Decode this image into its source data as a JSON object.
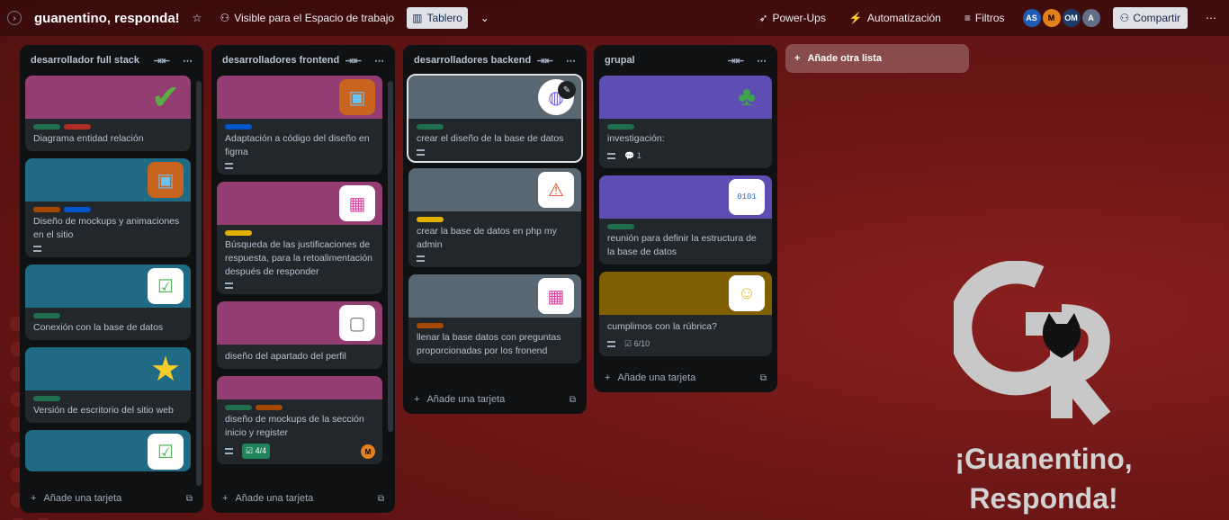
{
  "colors": {
    "green": "#216e4e",
    "red": "#ae2e24",
    "orange": "#a54800",
    "blue": "#0055cc",
    "yellow": "#e2b203",
    "pink": "#943d73",
    "teal": "#206a83",
    "slate": "#596773",
    "purple": "#5e4db2",
    "olive": "#7f5f01"
  },
  "topbar": {
    "title": "guanentino, responda!",
    "visibility": "Visible para el Espacio de trabajo",
    "view": "Tablero",
    "powerups": "Power-Ups",
    "automation": "Automatización",
    "filters": "Filtros",
    "share": "Compartir",
    "avatars": [
      "AS",
      "M",
      "OM",
      "A"
    ]
  },
  "lists": [
    {
      "title": "desarrollador full stack",
      "add": "Añade una tarjeta",
      "cards": [
        {
          "title": "Diagrama entidad relación",
          "sticker": "check-sticker-icon"
        },
        {
          "title": "Diseño de mockups y animaciones en el sitio",
          "sticker": "box-sticker-icon"
        },
        {
          "title": "Conexión con la base de datos",
          "sticker": "computer-sticker-icon"
        },
        {
          "title": "Versión de escritorio del sitio web",
          "sticker": "star-sticker-icon"
        },
        {
          "title": "",
          "sticker": "computer-sticker-icon"
        }
      ]
    },
    {
      "title": "desarrolladores frontend",
      "add": "Añade una tarjeta",
      "cards": [
        {
          "title": "Adaptación a código del diseño en figma"
        },
        {
          "title": "Búsqueda de las justificaciones de respuesta, para la retoalimentación después de responder"
        },
        {
          "title": "diseño del apartado del perfil"
        },
        {
          "title": "diseño de mockups de la sección inicio y register",
          "checklist": "4/4",
          "member": "M"
        }
      ]
    },
    {
      "title": "desarrolladores backend",
      "add": "Añade una tarjeta",
      "cards": [
        {
          "title": "crear el diseño de la base de datos"
        },
        {
          "title": "crear la base de datos en php my admin"
        },
        {
          "title": "llenar la base datos con preguntas proporcionadas por los fronend"
        }
      ]
    },
    {
      "title": "grupal",
      "add": "Añade una tarjeta",
      "cards": [
        {
          "title": "investigación:",
          "comments": "1"
        },
        {
          "title": "reunión para definir la estructura de la base de datos"
        },
        {
          "title": "cumplimos con la rúbrica?",
          "checklist": "6/10"
        }
      ]
    }
  ],
  "addlist": "Añade otra lista",
  "background": {
    "line1": "¡Guanentino,",
    "line2": "Responda!"
  }
}
